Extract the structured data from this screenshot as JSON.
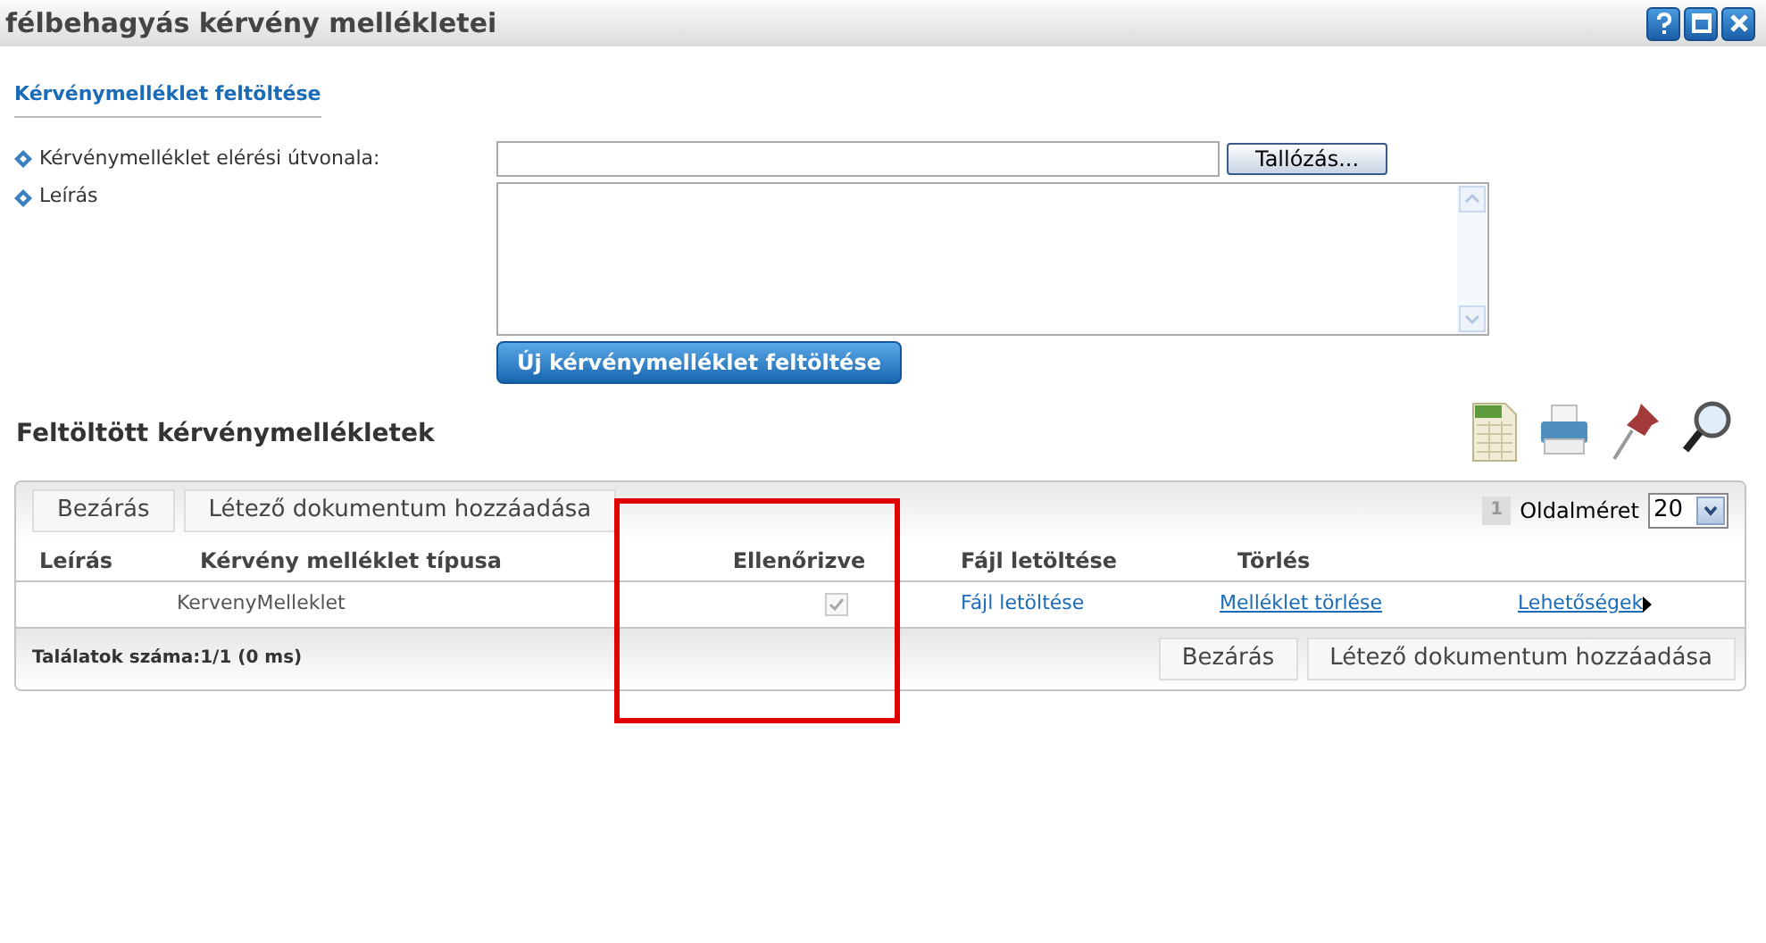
{
  "window": {
    "title": "félbehagyás kérvény mellékletei",
    "buttons": [
      {
        "kind": "help"
      },
      {
        "kind": "maximize"
      },
      {
        "kind": "close"
      }
    ]
  },
  "upload": {
    "heading": "Kérvénymelléklet feltöltése",
    "fields": [
      {
        "kind": "file",
        "label": "Kérvénymelléklet elérési útvonala:",
        "button": "Tallózás..."
      },
      {
        "kind": "textarea",
        "label": "Leírás"
      }
    ],
    "submit": "Új kérvénymelléklet feltöltése"
  },
  "uploaded": {
    "heading": "Feltöltött kérvénymellékletek",
    "tools": [
      {
        "kind": "xls"
      },
      {
        "kind": "print"
      },
      {
        "kind": "pin"
      },
      {
        "kind": "search"
      }
    ]
  },
  "grid": {
    "top_buttons": [
      "Bezárás",
      "Létező dokumentum hozzáadása"
    ],
    "page": "1",
    "page_size_label": "Oldalméret",
    "page_size": "20",
    "columns": [
      "Leírás",
      "Kérvény melléklet típusa",
      "Ellenőrizve",
      "Fájl letöltése",
      "Törlés"
    ],
    "rows": [
      {
        "description": "",
        "type": "KervenyMelleklet",
        "checked": true,
        "download": "Fájl letöltése",
        "delete": "Melléklet törlése",
        "options": "Lehetőségek"
      }
    ],
    "results": "Találatok száma:1/1 (0 ms)",
    "bottom_buttons": [
      "Bezárás",
      "Létező dokumentum hozzáadása"
    ]
  },
  "annotations": [
    {
      "kind": "rectangle",
      "color": "#e00000"
    }
  ]
}
